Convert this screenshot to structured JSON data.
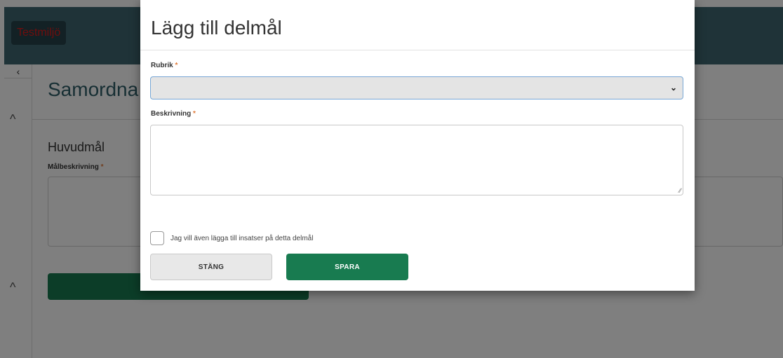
{
  "background": {
    "env_badge": "Testmiljö",
    "rail_toggle": "‹",
    "page_title": "Samordna",
    "section_title": "Huvudmål",
    "goal_label": "Målbeskrivning",
    "required_mark": "*",
    "collapse_icon": "chevron-up"
  },
  "modal": {
    "title": "Lägg till delmål",
    "rubrik_label": "Rubrik",
    "rubrik_value": "",
    "beskrivning_label": "Beskrivning",
    "beskrivning_value": "",
    "required_mark": "*",
    "checkbox_label": "Jag vill även lägga till insatser på detta delmål",
    "checkbox_checked": false,
    "close_button": "STÄNG",
    "save_button": "SPARA"
  },
  "colors": {
    "topbar": "#3f6770",
    "accent_green": "#187b50",
    "env_badge_text": "#e01b1b",
    "required": "#e07b3a"
  }
}
